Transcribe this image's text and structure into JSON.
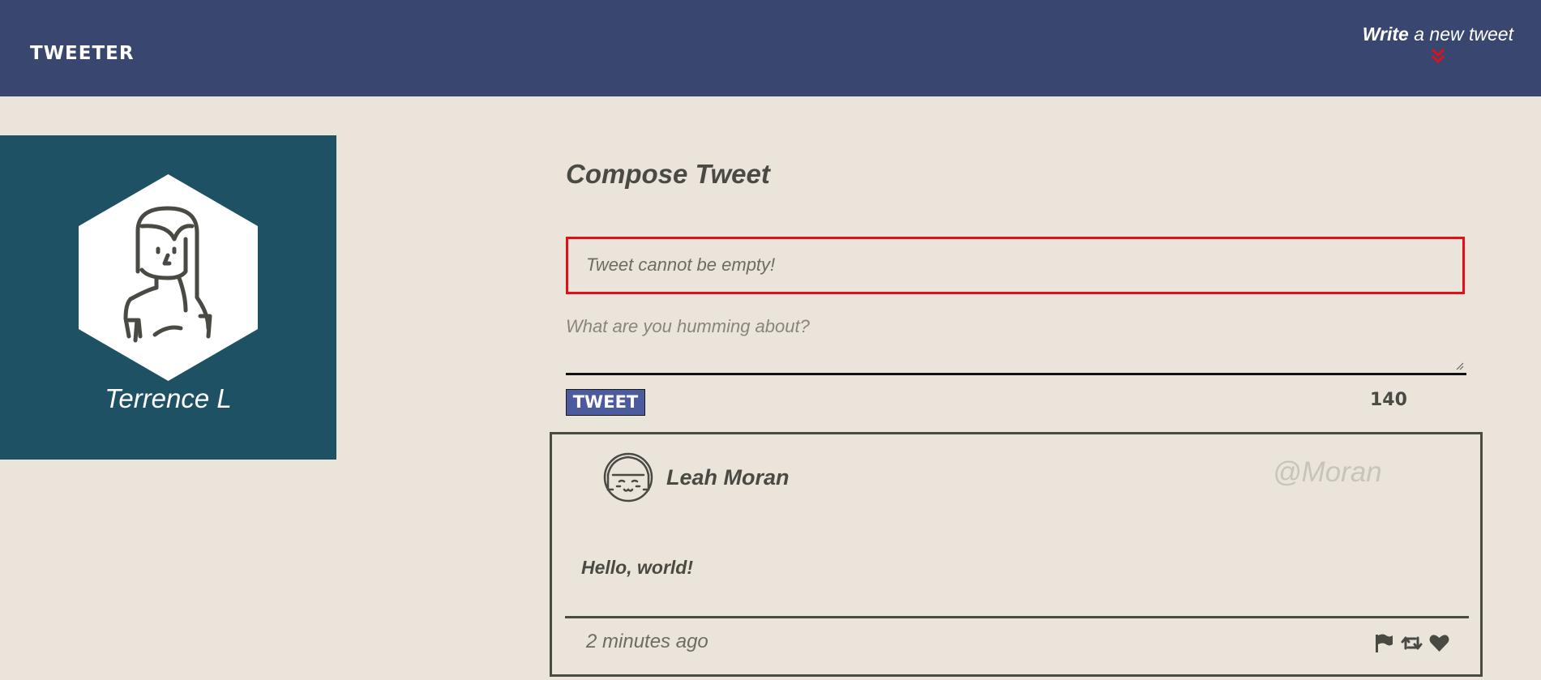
{
  "nav": {
    "brand": "TWEETER",
    "write_bold": "Write",
    "write_rest": " a new tweet",
    "arrow_icon": "double-chevron-down-icon",
    "arrow_color": "#e0101a"
  },
  "profile": {
    "name": "Terrence L",
    "avatar_icon": "user-avatar-icon"
  },
  "compose": {
    "title": "Compose Tweet",
    "error": "Tweet cannot be empty!",
    "placeholder": "What are you humming about?",
    "button_label": "TWEET",
    "counter": "140"
  },
  "tweet": {
    "author": "Leah Moran",
    "handle": "@Moran",
    "body": "Hello, world!",
    "time": "2 minutes ago",
    "actions": [
      "flag-icon",
      "retweet-icon",
      "heart-icon"
    ]
  },
  "colors": {
    "nav_bg": "#394770",
    "page_bg": "#ebe4da",
    "profile_bg": "#1e5164",
    "button_bg": "#4c5b9e",
    "error": "#e0101a"
  }
}
